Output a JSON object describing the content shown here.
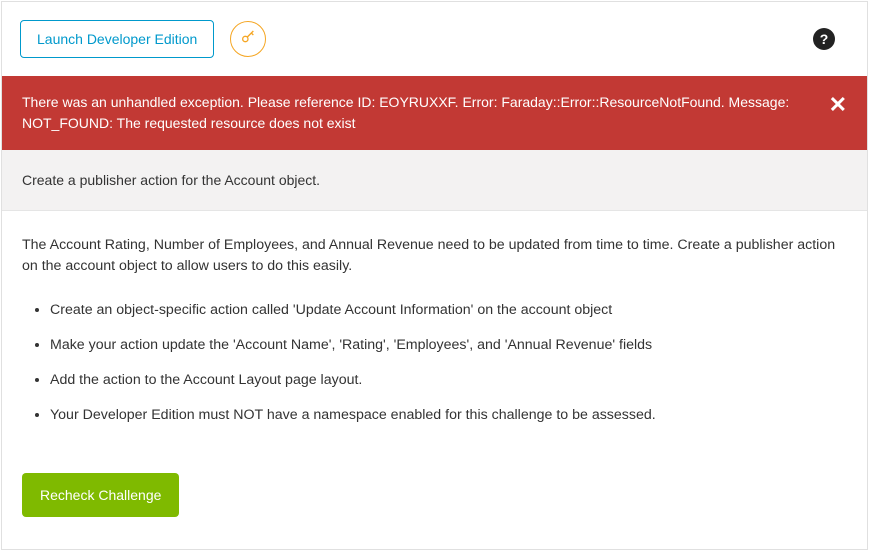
{
  "header": {
    "launch_label": "Launch Developer Edition",
    "key_icon": "key-icon",
    "help_icon_text": "?"
  },
  "error": {
    "message": "There was an unhandled exception. Please reference ID: EOYRUXXF. Error: Faraday::Error::ResourceNotFound. Message: NOT_FOUND: The requested resource does not exist",
    "close_label": "✕"
  },
  "subtitle": "Create a publisher action for the Account object.",
  "intro": "The Account Rating, Number of Employees, and Annual Revenue need to be updated from time to time. Create a publisher action on the account object to allow users to do this easily.",
  "requirements": [
    "Create an object-specific action called 'Update Account Information' on the account object",
    "Make your action update the 'Account Name', 'Rating', 'Employees', and 'Annual Revenue' fields",
    "Add the action to the Account Layout page layout.",
    "Your Developer Edition must NOT have a namespace enabled for this challenge to be assessed."
  ],
  "recheck_label": "Recheck Challenge"
}
